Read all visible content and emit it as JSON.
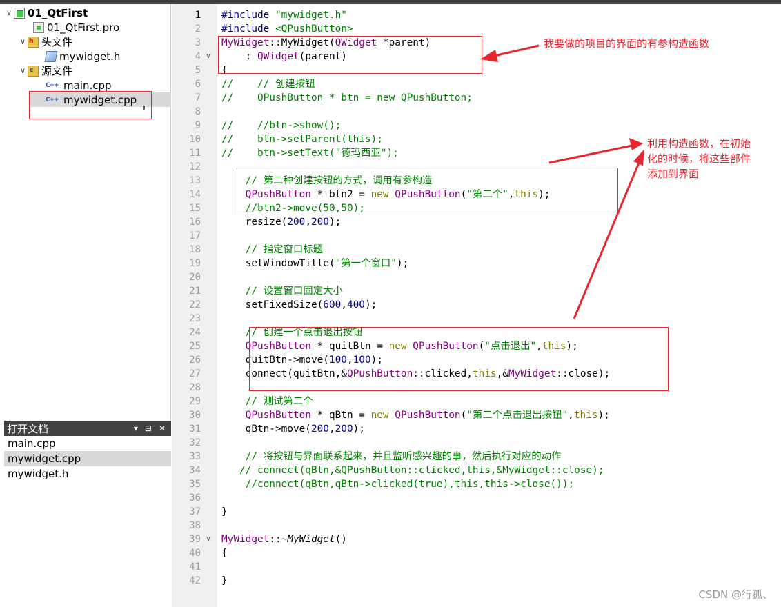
{
  "project_tree": {
    "project_name": "01_QtFirst",
    "pro_file": "01_QtFirst.pro",
    "headers_folder": "头文件",
    "header_file": "mywidget.h",
    "sources_folder": "源文件",
    "source_files": [
      "main.cpp",
      "mywidget.cpp"
    ]
  },
  "open_documents": {
    "title": "打开文档",
    "items": [
      "main.cpp",
      "mywidget.cpp",
      "mywidget.h"
    ],
    "active": "mywidget.cpp"
  },
  "editor": {
    "current_line": 1,
    "line_numbers": [
      "1",
      "2",
      "3",
      "4",
      "5",
      "6",
      "7",
      "8",
      "9",
      "10",
      "11",
      "12",
      "13",
      "14",
      "15",
      "16",
      "17",
      "18",
      "19",
      "20",
      "21",
      "22",
      "23",
      "24",
      "25",
      "26",
      "27",
      "28",
      "29",
      "30",
      "31",
      "32",
      "33",
      "34",
      "35",
      "36",
      "37",
      "38",
      "39",
      "40",
      "41",
      "42"
    ],
    "lines": [
      [
        [
          "pp",
          "#include "
        ],
        [
          "str",
          "\"mywidget.h\""
        ]
      ],
      [
        [
          "pp",
          "#include "
        ],
        [
          "str",
          "<QPushButton>"
        ]
      ],
      [
        [
          "type",
          "MyWidget"
        ],
        [
          "",
          "::MyWidget("
        ],
        [
          "type",
          "QWidget"
        ],
        [
          "",
          " *parent)"
        ]
      ],
      [
        [
          "",
          "    : "
        ],
        [
          "type",
          "QWidget"
        ],
        [
          "",
          "(parent)"
        ]
      ],
      [
        [
          "",
          "{"
        ]
      ],
      [
        [
          "com",
          "//    // 创建按钮"
        ]
      ],
      [
        [
          "com",
          "//    QPushButton * btn = new QPushButton;"
        ]
      ],
      [
        [
          "",
          ""
        ]
      ],
      [
        [
          "com",
          "//    //btn->show();"
        ]
      ],
      [
        [
          "com",
          "//    btn->setParent(this);"
        ]
      ],
      [
        [
          "com",
          "//    btn->setText(\"德玛西亚\");"
        ]
      ],
      [
        [
          "",
          ""
        ]
      ],
      [
        [
          "com",
          "    // 第二种创建按钮的方式，调用有参构造"
        ]
      ],
      [
        [
          "",
          "    "
        ],
        [
          "type",
          "QPushButton"
        ],
        [
          "",
          " * btn2 = "
        ],
        [
          "kw",
          "new"
        ],
        [
          "",
          " "
        ],
        [
          "type",
          "QPushButton"
        ],
        [
          "",
          "("
        ],
        [
          "str",
          "\"第二个\""
        ],
        [
          "",
          ","
        ],
        [
          "kw",
          "this"
        ],
        [
          "",
          ");"
        ]
      ],
      [
        [
          "com",
          "    //btn2->move(50,50);"
        ]
      ],
      [
        [
          "",
          "    resize("
        ],
        [
          "num",
          "200"
        ],
        [
          "",
          ","
        ],
        [
          "num",
          "200"
        ],
        [
          "",
          ");"
        ]
      ],
      [
        [
          "",
          ""
        ]
      ],
      [
        [
          "com",
          "    // 指定窗口标题"
        ]
      ],
      [
        [
          "",
          "    setWindowTitle("
        ],
        [
          "str",
          "\"第一个窗口\""
        ],
        [
          "",
          ");"
        ]
      ],
      [
        [
          "",
          ""
        ]
      ],
      [
        [
          "com",
          "    // 设置窗口固定大小"
        ]
      ],
      [
        [
          "",
          "    setFixedSize("
        ],
        [
          "num",
          "600"
        ],
        [
          "",
          ","
        ],
        [
          "num",
          "400"
        ],
        [
          "",
          ");"
        ]
      ],
      [
        [
          "",
          ""
        ]
      ],
      [
        [
          "com",
          "    // 创建一个点击退出按钮"
        ]
      ],
      [
        [
          "",
          "    "
        ],
        [
          "type",
          "QPushButton"
        ],
        [
          "",
          " * quitBtn = "
        ],
        [
          "kw",
          "new"
        ],
        [
          "",
          " "
        ],
        [
          "type",
          "QPushButton"
        ],
        [
          "",
          "("
        ],
        [
          "str",
          "\"点击退出\""
        ],
        [
          "",
          ","
        ],
        [
          "kw",
          "this"
        ],
        [
          "",
          ");"
        ]
      ],
      [
        [
          "",
          "    quitBtn->move("
        ],
        [
          "num",
          "100"
        ],
        [
          "",
          ","
        ],
        [
          "num",
          "100"
        ],
        [
          "",
          ");"
        ]
      ],
      [
        [
          "",
          "    connect(quitBtn,&"
        ],
        [
          "type",
          "QPushButton"
        ],
        [
          "",
          "::clicked,"
        ],
        [
          "kw",
          "this"
        ],
        [
          "",
          ",&"
        ],
        [
          "type",
          "MyWidget"
        ],
        [
          "",
          "::close);"
        ]
      ],
      [
        [
          "",
          ""
        ]
      ],
      [
        [
          "com",
          "    // 测试第二个"
        ]
      ],
      [
        [
          "",
          "    "
        ],
        [
          "type",
          "QPushButton"
        ],
        [
          "",
          " * qBtn = "
        ],
        [
          "kw",
          "new"
        ],
        [
          "",
          " "
        ],
        [
          "type",
          "QPushButton"
        ],
        [
          "",
          "("
        ],
        [
          "str",
          "\"第二个点击退出按钮\""
        ],
        [
          "",
          ","
        ],
        [
          "kw",
          "this"
        ],
        [
          "",
          ");"
        ]
      ],
      [
        [
          "",
          "    qBtn->move("
        ],
        [
          "num",
          "200"
        ],
        [
          "",
          ","
        ],
        [
          "num",
          "200"
        ],
        [
          "",
          ");"
        ]
      ],
      [
        [
          "",
          ""
        ]
      ],
      [
        [
          "com",
          "    // 将按钮与界面联系起来，并且监听感兴趣的事，然后执行对应的动作"
        ]
      ],
      [
        [
          "com",
          "   // connect(qBtn,&QPushButton::clicked,this,&MyWidget::close);"
        ]
      ],
      [
        [
          "com",
          "    //connect(qBtn,qBtn->clicked(true),this,this->close());"
        ]
      ],
      [
        [
          "",
          ""
        ]
      ],
      [
        [
          "",
          "}"
        ]
      ],
      [
        [
          "",
          ""
        ]
      ],
      [
        [
          "type",
          "MyWidget"
        ],
        [
          "",
          "::~"
        ],
        [
          "ital",
          "MyWidget"
        ],
        [
          "",
          "()"
        ]
      ],
      [
        [
          "",
          "{"
        ]
      ],
      [
        [
          "",
          ""
        ]
      ],
      [
        [
          "",
          "}"
        ]
      ]
    ],
    "fold_lines": [
      4,
      39
    ]
  },
  "annotations": {
    "note_1": "我要做的项目的界面的有参构造函数",
    "note_2_lines": [
      "利用构造函数，在初始",
      "化的时候，将这些部件",
      "添加到界面"
    ]
  },
  "colors": {
    "annotation": "#e8262f",
    "comment": "#008000",
    "type": "#800080",
    "keyword": "#808000",
    "number": "#000080"
  },
  "watermark": "CSDN @行孤、"
}
